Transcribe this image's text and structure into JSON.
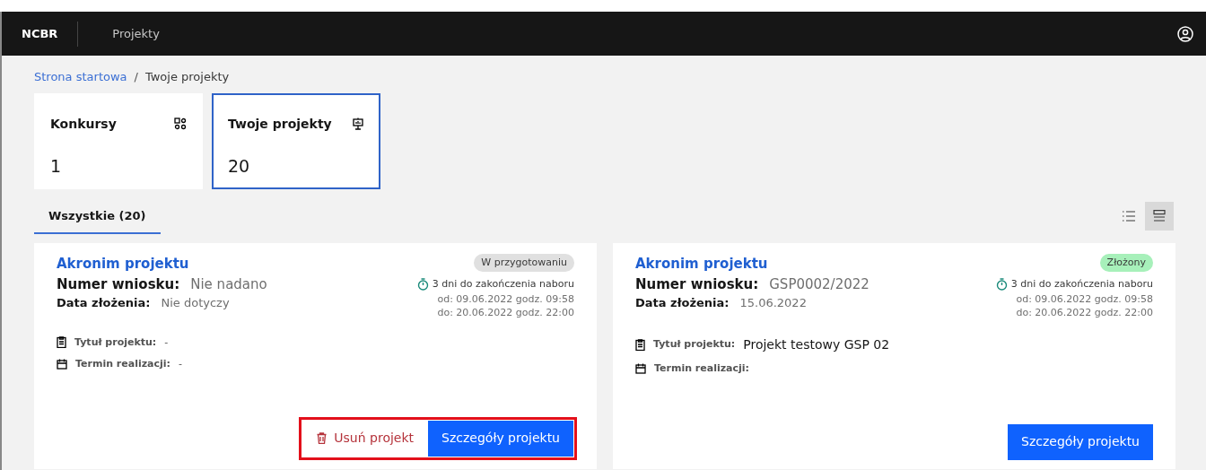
{
  "header": {
    "brand": "NCBR",
    "nav_item": "Projekty"
  },
  "breadcrumb": [
    {
      "label": "Strona startowa",
      "link": true
    },
    {
      "label": "Twoje projekty",
      "link": false
    }
  ],
  "breadcrumb_separator": "/",
  "tiles": [
    {
      "title": "Konkursy",
      "kind": "apps",
      "count": "1",
      "selected": false
    },
    {
      "title": "Twoje projekty",
      "kind": "presentation",
      "count": "20",
      "selected": true
    }
  ],
  "tabs": [
    {
      "label": "Wszystkie (20)",
      "selected": true
    }
  ],
  "view_toggles": [
    {
      "kind": "list",
      "selected": false
    },
    {
      "kind": "cards",
      "selected": true
    }
  ],
  "cards": [
    {
      "acronym": "Akronim projektu",
      "status": {
        "label": "W przygotowaniu",
        "color": "#e0e0e0"
      },
      "number_label": "Numer wniosku:",
      "number": "Nie nadano",
      "date_label": "Data złożenia:",
      "date": "Nie dotyczy",
      "deadline": "3 dni do zakończenia naboru",
      "from": "od: 09.06.2022 godz. 09:58",
      "to": "do: 20.06.2022 godz. 22:00",
      "title_label": "Tytuł projektu:",
      "title": "-",
      "term_label": "Termin realizacji:",
      "term": "-",
      "highlighted": true,
      "actions": [
        {
          "kind": "delete",
          "label": "Usuń projekt"
        },
        {
          "kind": "primary",
          "label": "Szczegóły projektu"
        }
      ]
    },
    {
      "acronym": "Akronim projektu",
      "status": {
        "label": "Złożony",
        "color": "#a7f0ba"
      },
      "number_label": "Numer wniosku:",
      "number": "GSP0002/2022",
      "date_label": "Data złożenia:",
      "date": "15.06.2022",
      "deadline": "3 dni do zakończenia naboru",
      "from": "od: 09.06.2022 godz. 09:58",
      "to": "do: 20.06.2022 godz. 22:00",
      "title_label": "Tytuł projektu:",
      "title": "Projekt testowy GSP 02",
      "term_label": "Termin realizacji:",
      "highlighted": false,
      "actions": [
        {
          "kind": "primary",
          "label": "Szczegóły projektu"
        }
      ]
    }
  ]
}
